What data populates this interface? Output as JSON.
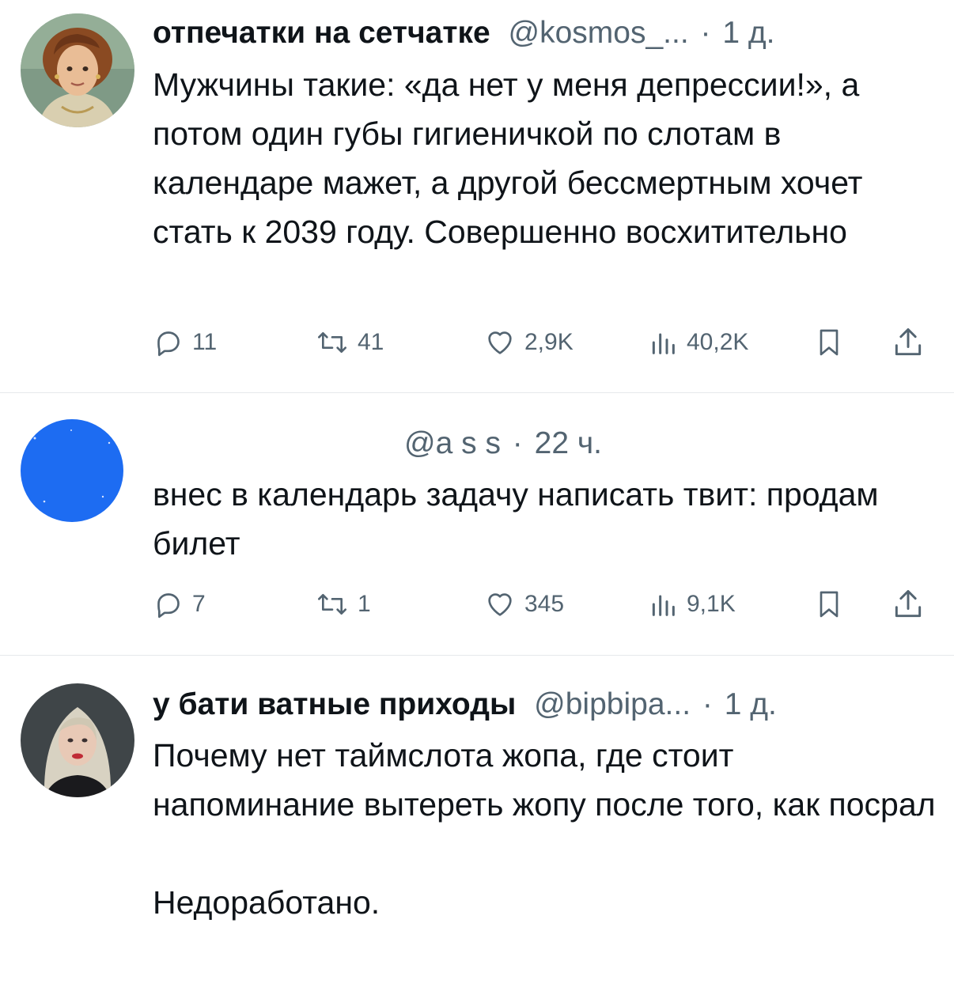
{
  "tweets": [
    {
      "name": "отпечатки на сетчатке",
      "handle": "@kosmos_...",
      "sep": "·",
      "time": "1 д.",
      "text": [
        "Мужчины такие: «да нет у меня депрессии!», а потом один губы гигиеничкой по слотам в календаре мажет, а другой бессмертным хочет стать к 2039 году. Совершенно восхитительно"
      ],
      "replies": "11",
      "retweets": "41",
      "likes": "2,9K",
      "views": "40,2K"
    },
    {
      "name": "",
      "handle": "@a s s",
      "sep": "·",
      "time": "22 ч.",
      "text": [
        "внес в календарь задачу написать твит: продам билет"
      ],
      "replies": "7",
      "retweets": "1",
      "likes": "345",
      "views": "9,1K"
    },
    {
      "name": "у бати ватные приходы",
      "handle": "@bipbipa...",
      "sep": "·",
      "time": "1 д.",
      "text": [
        "Почему нет таймслота жопа, где стоит напоминание вытереть жопу после того, как посрал",
        "Недоработано."
      ]
    }
  ],
  "icons": {
    "reply": "reply-icon",
    "retweet": "retweet-icon",
    "like": "heart-icon",
    "views": "views-icon",
    "bookmark": "bookmark-icon",
    "share": "share-icon"
  },
  "colors": {
    "text": "#0f1419",
    "secondary": "#536471",
    "divider": "#e6e9eb",
    "avatar2": "#1d6cf2"
  }
}
